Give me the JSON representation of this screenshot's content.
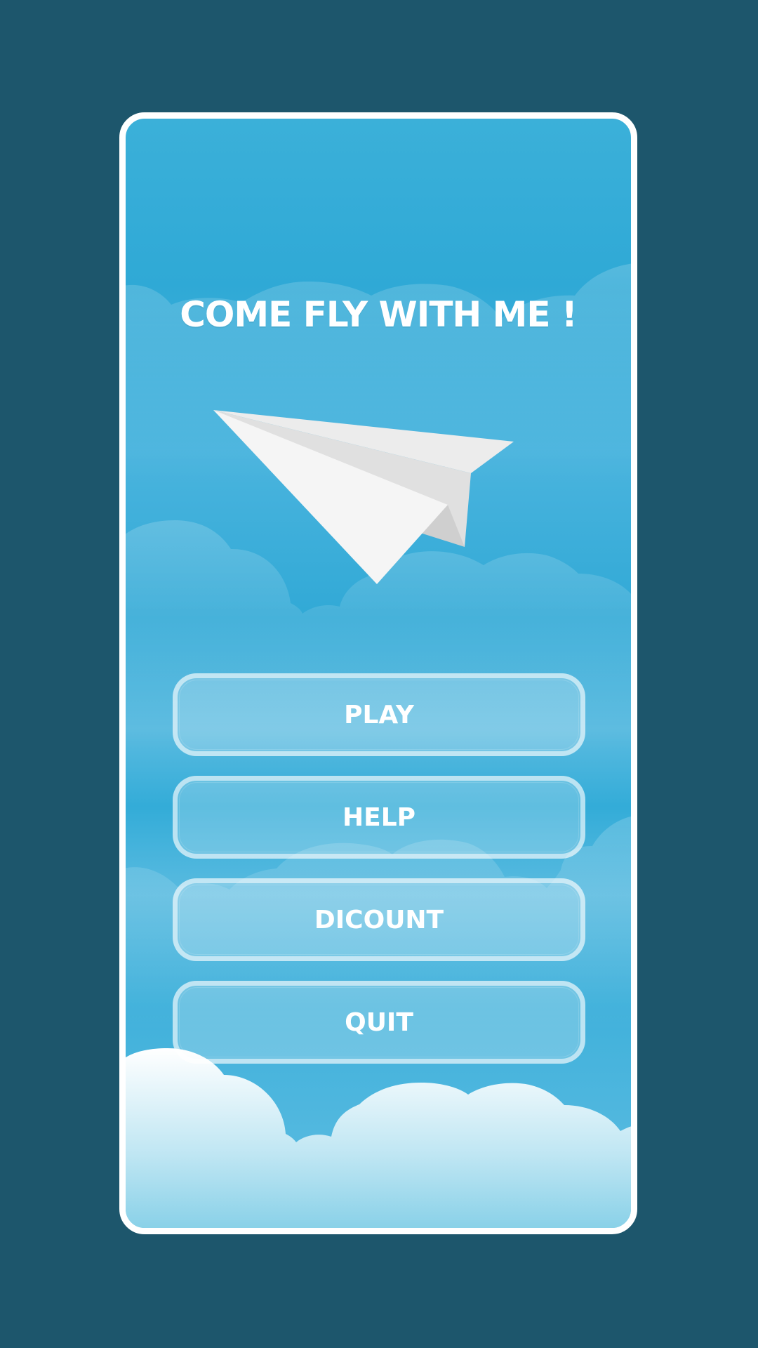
{
  "title": "COME FLY WITH ME !",
  "menu": {
    "play_label": "PLAY",
    "help_label": "HELP",
    "discount_label": "DICOUNT",
    "quit_label": "QUIT"
  },
  "icons": {
    "hero": "paper-plane-icon"
  },
  "colors": {
    "background": "#1d566c",
    "sky": "#31a9d6",
    "frame": "#ffffff",
    "text": "#ffffff"
  }
}
